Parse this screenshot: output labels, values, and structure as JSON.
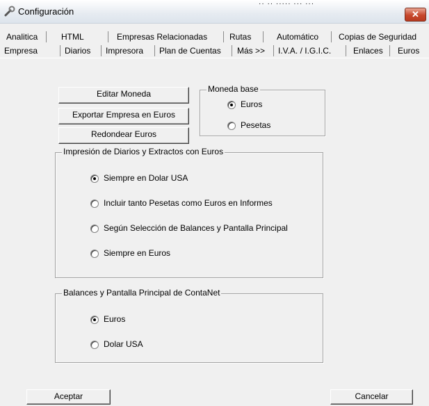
{
  "window": {
    "title": "Configuración",
    "close_glyph": "✕",
    "icon": "wrench-icon",
    "dots": "·· ·· ····· ··· ···"
  },
  "tabs_row1": [
    "Analitica",
    "HTML",
    "Empresas Relacionadas",
    "Rutas",
    "Automático",
    "Copias de Seguridad"
  ],
  "tabs_row2": [
    "Empresa",
    "Diarios",
    "Impresora",
    "Plan de Cuentas",
    "Más >>",
    "I.V.A. / I.G.I.C.",
    "Enlaces",
    "Euros"
  ],
  "buttons": {
    "editar": "Editar Moneda",
    "exportar": "Exportar Empresa en Euros",
    "redondear": "Redondear Euros",
    "aceptar": "Aceptar",
    "cancelar": "Cancelar"
  },
  "moneda_base": {
    "title": "Moneda base",
    "options": [
      "Euros",
      "Pesetas"
    ],
    "selected": "Euros"
  },
  "impresion": {
    "title": "Impresión de Diarios y Extractos con Euros",
    "options": [
      "Siempre en Dolar USA",
      "Incluir tanto Pesetas como Euros en Informes",
      "Según Selección de Balances y Pantalla Principal",
      "Siempre en Euros"
    ],
    "selected": "Siempre en Dolar USA"
  },
  "balances": {
    "title": "Balances y Pantalla Principal de ContaNet",
    "options": [
      "Euros",
      "Dolar USA"
    ],
    "selected": "Euros"
  },
  "colors": {
    "close": "#c7472c",
    "face": "#f0f0f0"
  }
}
